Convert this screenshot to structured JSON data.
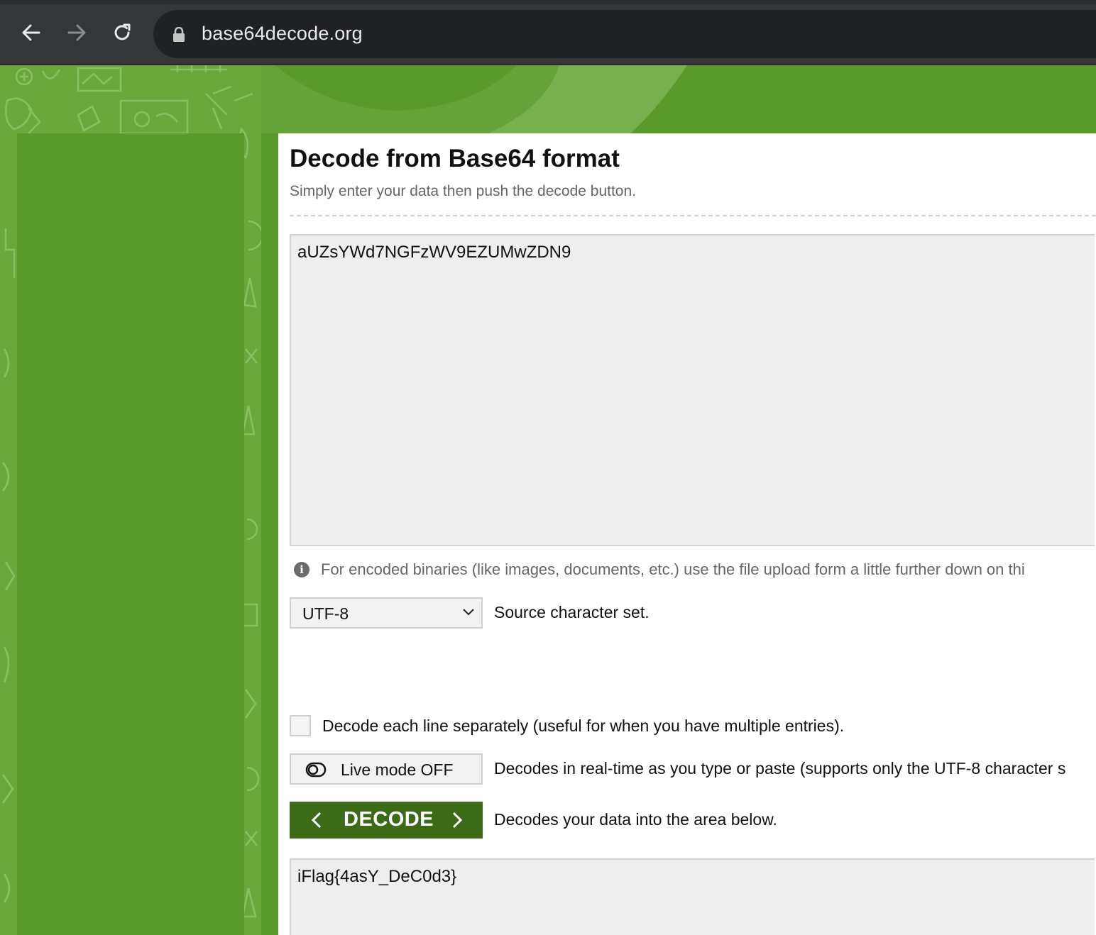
{
  "browser": {
    "url": "base64decode.org",
    "back_icon": "arrow-left-icon",
    "forward_icon": "arrow-right-icon",
    "reload_icon": "reload-icon",
    "lock_icon": "lock-icon"
  },
  "main": {
    "title": "Decode from Base64 format",
    "subtitle": "Simply enter your data then push the decode button.",
    "input_value": "aUZsYWd7NGFzWV9EZUMwZDN9",
    "info_text": "For encoded binaries (like images, documents, etc.) use the file upload form a little further down on thi",
    "charset": {
      "selected": "UTF-8",
      "label": "Source character set."
    },
    "separate_lines": {
      "checked": false,
      "label": "Decode each line separately (useful for when you have multiple entries)."
    },
    "live_mode": {
      "button_label": "Live mode OFF",
      "description": "Decodes in real-time as you type or paste (supports only the UTF-8 character s"
    },
    "decode": {
      "button_label": "DECODE",
      "description": "Decodes your data into the area below."
    },
    "output_value": "iFlag{4asY_DeC0d3}"
  },
  "colors": {
    "brand_green": "#5a9a2d",
    "pattern_green": "#6aa83d",
    "decode_button": "#3b6b17",
    "chrome_bar": "#35363a",
    "omnibox": "#202124"
  }
}
